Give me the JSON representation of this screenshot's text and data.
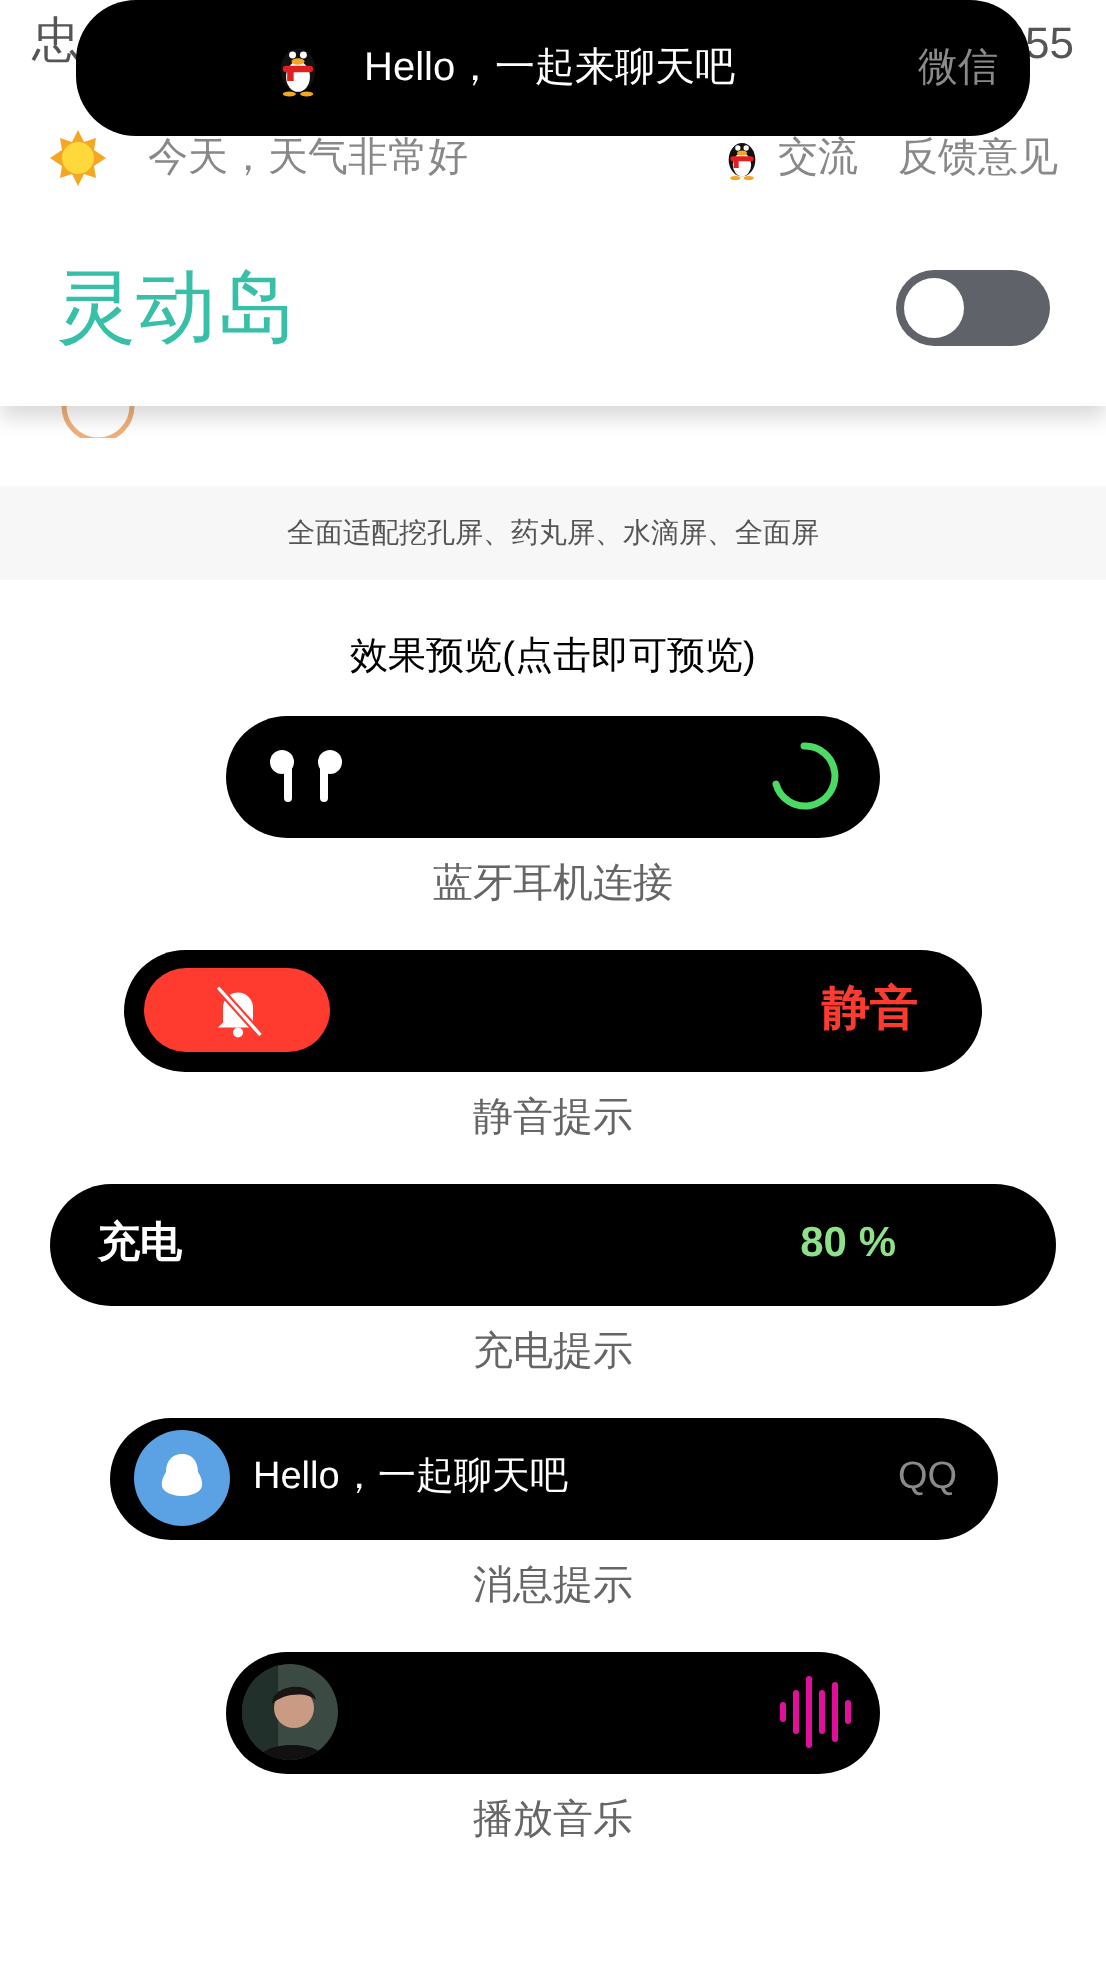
{
  "status_bar": {
    "left": "忠",
    "time": "55"
  },
  "island_popup": {
    "message": "Hello，一起来聊天吧",
    "source": "微信"
  },
  "top_bar": {
    "weather": "今天，天气非常好",
    "links": [
      "交流",
      "反馈意见"
    ]
  },
  "header": {
    "title": "灵动岛",
    "toggle": {
      "on": false
    }
  },
  "notice": "全面适配挖孔屏、药丸屏、水滴屏、全面屏",
  "preview_title": "效果预览(点击即可预览)",
  "previews": [
    {
      "kind": "airpods",
      "caption": "蓝牙耳机连接"
    },
    {
      "kind": "mute",
      "right_text": "静音",
      "caption": "静音提示"
    },
    {
      "kind": "charge",
      "left_text": "充电",
      "right_text": "80 %",
      "caption": "充电提示"
    },
    {
      "kind": "message",
      "text": "Hello，一起聊天吧",
      "right_text": "QQ",
      "caption": "消息提示"
    },
    {
      "kind": "music",
      "caption": "播放音乐"
    }
  ]
}
